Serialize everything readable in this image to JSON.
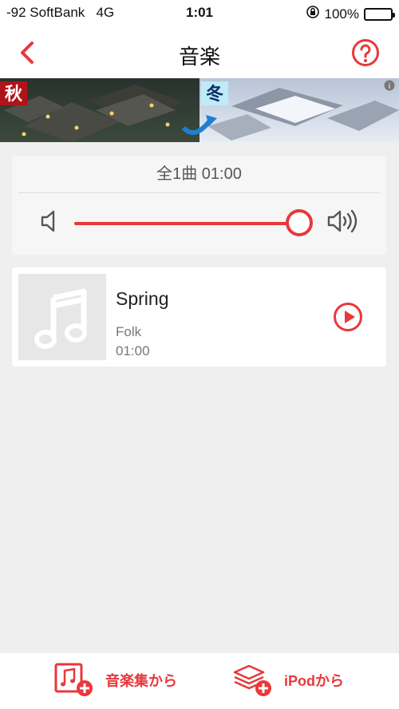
{
  "status_bar": {
    "signal": "-92 SoftBank",
    "network": "4G",
    "time": "1:01",
    "battery_text": "100%",
    "battery_level": 1.0
  },
  "nav": {
    "title": "音楽",
    "back_icon": "chevron-left-icon",
    "help_icon": "question-circle-icon"
  },
  "ad": {
    "left_badge": "秋",
    "right_badge": "冬",
    "info_icon": "info-icon"
  },
  "volume": {
    "summary": "全1曲  01:00",
    "level": 1.0,
    "low_icon": "speaker-low-icon",
    "high_icon": "speaker-high-icon"
  },
  "tracks": [
    {
      "title": "Spring",
      "genre": "Folk",
      "duration": "01:00",
      "artwork_icon": "music-note-icon",
      "play_icon": "play-circle-icon"
    }
  ],
  "toolbar": {
    "from_music_label": "音楽集から",
    "from_ipod_label": "iPodから",
    "from_music_icon": "music-add-icon",
    "from_ipod_icon": "layers-add-icon"
  },
  "colors": {
    "accent": "#e8383b",
    "background": "#efefef",
    "card": "#ffffff"
  }
}
